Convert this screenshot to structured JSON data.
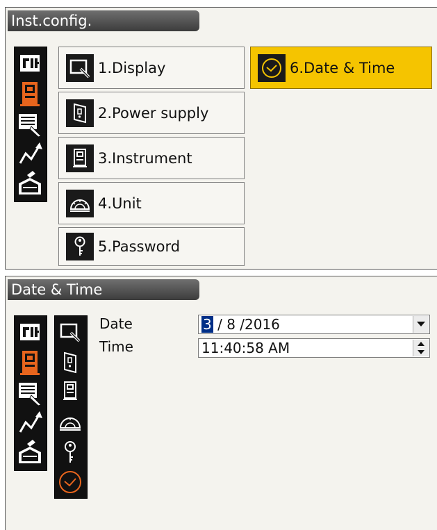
{
  "top": {
    "title": "Inst.config.",
    "sidebar_icons": [
      "tilt-icon",
      "instrument-icon",
      "keyboard-icon",
      "graph-icon",
      "toolbox-icon"
    ],
    "menu": [
      {
        "label": "1.Display",
        "icon": "display-icon"
      },
      {
        "label": "2.Power supply",
        "icon": "power-supply-icon"
      },
      {
        "label": "3.Instrument",
        "icon": "instrument-icon"
      },
      {
        "label": "4.Unit",
        "icon": "unit-icon"
      },
      {
        "label": "5.Password",
        "icon": "password-key-icon"
      },
      {
        "label": "6.Date & Time",
        "icon": "clock-icon",
        "selected": true
      }
    ]
  },
  "bottom": {
    "title": "Date & Time",
    "date_label": "Date",
    "time_label": "Time",
    "date_value_selected": "3",
    "date_value_rest": " / 8 /2016",
    "time_value": "11:40:58 AM"
  },
  "colors": {
    "selected_bg": "#f5c400",
    "accent_orange": "#e8651d",
    "highlight": "#002f87"
  }
}
